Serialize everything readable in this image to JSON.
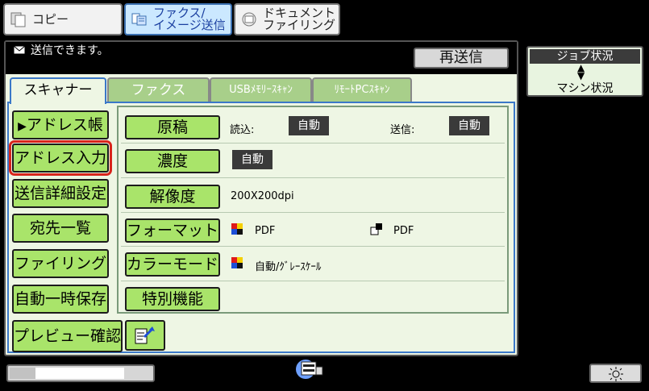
{
  "modes": [
    {
      "label": "コピー",
      "icon": "copy-icon",
      "active": false
    },
    {
      "label_line1": "ファクス/",
      "label_line2": "イメージ送信",
      "icon": "fax-scan-icon",
      "active": true
    },
    {
      "label_line1": "ドキュメント",
      "label_line2": "ファイリング",
      "icon": "filing-icon",
      "active": false
    }
  ],
  "status": {
    "message": "送信できます。",
    "icon": "envelope-icon"
  },
  "resend_label": "再送信",
  "tabs": [
    {
      "label": "スキャナー",
      "active": true
    },
    {
      "label": "ファクス",
      "active": false
    },
    {
      "label": "USBﾒﾓﾘｰｽｷｬﾝ",
      "active": false
    },
    {
      "label": "ﾘﾓｰﾄPCｽｷｬﾝ",
      "active": false
    }
  ],
  "nav": {
    "address_book": "アドレス帳",
    "address_entry": "アドレス入力",
    "send_detail": "送信詳細設定",
    "destination_list": "宛先一覧",
    "filing": "ファイリング",
    "auto_temp_save": "自動一時保存",
    "preview": "プレビュー確認"
  },
  "settings": {
    "original": {
      "label": "原稿",
      "read_label": "読込:",
      "read_value": "自動",
      "send_label": "送信:",
      "send_value": "自動"
    },
    "density": {
      "label": "濃度",
      "value": "自動"
    },
    "resolution": {
      "label": "解像度",
      "value": "200X200dpi"
    },
    "format": {
      "label": "フォーマット",
      "color_value": "PDF",
      "bw_value": "PDF"
    },
    "color_mode": {
      "label": "カラーモード",
      "value": "自動/ｸﾞﾚｰｽｹｰﾙ"
    },
    "special": {
      "label": "特別機能"
    }
  },
  "job_status": {
    "top": "ジョブ状況",
    "bottom": "マシン状況"
  },
  "colors": {
    "accent_green": "#a9e46a",
    "panel_bg": "#eef6e4",
    "selected_outline": "#d8241c",
    "tab_blue": "#3b78c8"
  }
}
